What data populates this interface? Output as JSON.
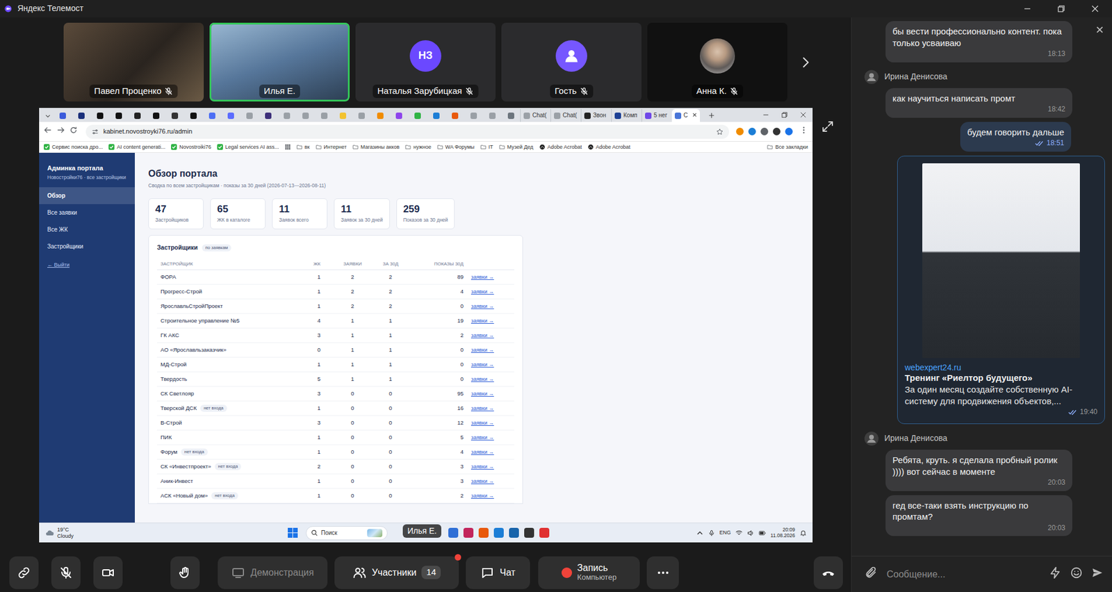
{
  "window": {
    "title": "Яндекс Телемост"
  },
  "participants": [
    {
      "name": "Павел Проценко",
      "kind": "video",
      "muted": true,
      "speaking": false
    },
    {
      "name": "Илья Е.",
      "kind": "video",
      "muted": false,
      "speaking": true
    },
    {
      "name": "Наталья Зарубицкая",
      "kind": "initials",
      "initials": "НЗ",
      "muted": true,
      "speaking": false
    },
    {
      "name": "Гость",
      "kind": "avatar",
      "muted": true,
      "speaking": false
    },
    {
      "name": "Анна К.",
      "kind": "photo",
      "muted": true,
      "speaking": false
    }
  ],
  "screen": {
    "browser": {
      "tabs": [
        {
          "kind": "icon",
          "color": "#3b5bdb",
          "selected": false
        },
        {
          "kind": "icon",
          "color": "#1a2f7a",
          "selected": false
        },
        {
          "kind": "icon",
          "color": "#111111",
          "selected": false
        },
        {
          "kind": "icon",
          "color": "#111111",
          "selected": false
        },
        {
          "kind": "icon",
          "color": "#222222",
          "selected": false
        },
        {
          "kind": "icon",
          "color": "#111111",
          "selected": false
        },
        {
          "kind": "icon",
          "color": "#333333",
          "selected": false
        },
        {
          "kind": "icon",
          "color": "#111111",
          "selected": false
        },
        {
          "kind": "icon",
          "color": "#4c6ef5",
          "selected": false
        },
        {
          "kind": "icon",
          "color": "#5b6cff",
          "selected": false
        },
        {
          "kind": "icon",
          "color": "#9aa0a6",
          "selected": false
        },
        {
          "kind": "icon",
          "color": "#3d2f7a",
          "selected": false
        },
        {
          "kind": "icon",
          "color": "#9aa0a6",
          "selected": false
        },
        {
          "kind": "icon",
          "color": "#9aa0a6",
          "selected": false
        },
        {
          "kind": "icon",
          "color": "#9aa0a6",
          "selected": false
        },
        {
          "kind": "icon",
          "color": "#f2c230",
          "selected": false
        },
        {
          "kind": "icon",
          "color": "#9aa0a6",
          "selected": false
        },
        {
          "kind": "icon",
          "color": "#f08c00",
          "selected": false
        },
        {
          "kind": "icon",
          "color": "#8e44ec",
          "selected": false
        },
        {
          "kind": "icon",
          "color": "#2fb344",
          "selected": false
        },
        {
          "kind": "icon",
          "color": "#1c7ed6",
          "selected": false
        },
        {
          "kind": "icon",
          "color": "#e8590c",
          "selected": false
        },
        {
          "kind": "icon",
          "color": "#9aa0a6",
          "selected": false
        },
        {
          "kind": "icon",
          "color": "#9aa0a6",
          "selected": false
        },
        {
          "kind": "icon",
          "color": "#6c757d",
          "selected": false
        },
        {
          "kind": "text",
          "label": "Chat(",
          "color": "#9aa0a6",
          "selected": false
        },
        {
          "kind": "text",
          "label": "Chat(",
          "color": "#9aa0a6",
          "selected": false
        },
        {
          "kind": "text",
          "label": "Звон",
          "color": "#222222",
          "selected": false
        },
        {
          "kind": "text",
          "label": "Комп",
          "color": "#1c3f94",
          "selected": false
        },
        {
          "kind": "text",
          "label": "5 нег",
          "color": "#7048e8",
          "selected": false
        },
        {
          "kind": "text",
          "label": "С",
          "color": "#4a76d8",
          "selected": true
        }
      ],
      "url": "kabinet.novostroyki76.ru/admin",
      "bookmarks": [
        {
          "kind": "check",
          "label": "Сервис поиска дро..."
        },
        {
          "kind": "check",
          "label": "AI content generati..."
        },
        {
          "kind": "check",
          "label": "Novostroiki76"
        },
        {
          "kind": "check",
          "label": "Legal services AI ass..."
        },
        {
          "kind": "folder",
          "label": "вк"
        },
        {
          "kind": "folder",
          "label": "Интернет"
        },
        {
          "kind": "folder",
          "label": "Магазины акков"
        },
        {
          "kind": "folder",
          "label": "нужное"
        },
        {
          "kind": "folder",
          "label": "WA Форумы"
        },
        {
          "kind": "folder",
          "label": "IT"
        },
        {
          "kind": "folder",
          "label": "Музей Дед"
        },
        {
          "kind": "acrobat",
          "label": "Adobe Acrobat"
        },
        {
          "kind": "acrobat",
          "label": "Adobe Acrobat"
        }
      ],
      "all_bookmarks": "Все закладки"
    },
    "portal": {
      "sidebar": {
        "title": "Админка портала",
        "subtitle": "Новостройки76 · все застройщики",
        "items": [
          {
            "label": "Обзор",
            "selected": true
          },
          {
            "label": "Все заявки",
            "selected": false
          },
          {
            "label": "Все ЖК",
            "selected": false
          },
          {
            "label": "Застройщики",
            "selected": false
          }
        ],
        "logout": "← Выйти"
      },
      "heading": "Обзор портала",
      "subheading": "Сводка по всем застройщикам · показы за 30 дней (2026-07-13—2026-08-11)",
      "stats": [
        {
          "value": "47",
          "label": "Застройщиков"
        },
        {
          "value": "65",
          "label": "ЖК в каталоге"
        },
        {
          "value": "11",
          "label": "Заявок всего"
        },
        {
          "value": "11",
          "label": "Заявок за 30 дней"
        },
        {
          "value": "259",
          "label": "Показов за 30 дней"
        }
      ],
      "table": {
        "title": "Застройщики",
        "badge": "по заявкам",
        "columns": [
          "ЗАСТРОЙЩИК",
          "ЖК",
          "ЗАЯВКИ",
          "ЗА 30Д",
          "ПОКАЗЫ 30Д"
        ],
        "rows": [
          {
            "name": "ФОРА",
            "cells": [
              "1",
              "2",
              "2",
              "89"
            ],
            "link": "заявки →"
          },
          {
            "name": "Прогресс-Строй",
            "cells": [
              "1",
              "2",
              "2",
              "4"
            ],
            "link": "заявки →"
          },
          {
            "name": "ЯрославльСтройПроект",
            "cells": [
              "1",
              "2",
              "2",
              "0"
            ],
            "link": "заявки →"
          },
          {
            "name": "Строительное управление №5",
            "cells": [
              "4",
              "1",
              "1",
              "19"
            ],
            "link": "заявки →"
          },
          {
            "name": "ГК АКС",
            "cells": [
              "3",
              "1",
              "1",
              "2"
            ],
            "link": "заявки →"
          },
          {
            "name": "АО «Ярославльзаказчик»",
            "cells": [
              "0",
              "1",
              "1",
              "0"
            ],
            "link": "заявки →"
          },
          {
            "name": "МД-Строй",
            "cells": [
              "1",
              "1",
              "1",
              "0"
            ],
            "link": "заявки →"
          },
          {
            "name": "Твердость",
            "cells": [
              "5",
              "1",
              "1",
              "0"
            ],
            "link": "заявки →"
          },
          {
            "name": "СК Светлояр",
            "cells": [
              "3",
              "0",
              "0",
              "95"
            ],
            "link": "заявки →"
          },
          {
            "name": "Тверской ДСК",
            "tag": "нет входа",
            "cells": [
              "1",
              "0",
              "0",
              "16"
            ],
            "link": "заявки →"
          },
          {
            "name": "В-Строй",
            "cells": [
              "3",
              "0",
              "0",
              "12"
            ],
            "link": "заявки →"
          },
          {
            "name": "ПИК",
            "cells": [
              "1",
              "0",
              "0",
              "5"
            ],
            "link": "заявки →"
          },
          {
            "name": "Форум",
            "tag": "нет входа",
            "cells": [
              "1",
              "0",
              "0",
              "4"
            ],
            "link": "заявки →"
          },
          {
            "name": "СК «Инвестпроект»",
            "tag": "нет входа",
            "cells": [
              "2",
              "0",
              "0",
              "3"
            ],
            "link": "заявки →"
          },
          {
            "name": "Аник-Инвест",
            "cells": [
              "1",
              "0",
              "0",
              "3"
            ],
            "link": "заявки →"
          },
          {
            "name": "АСК «Новый дом»",
            "tag": "нет входа",
            "cells": [
              "1",
              "0",
              "0",
              "2"
            ],
            "link": "заявки →"
          }
        ]
      }
    },
    "taskbar": {
      "weather": {
        "temp": "19°C",
        "desc": "Cloudy"
      },
      "search": "Поиск",
      "apps": [
        {
          "color": "#2f6fd6"
        },
        {
          "color": "#c2255c"
        },
        {
          "color": "#e8590c"
        },
        {
          "color": "#1c7ed6"
        },
        {
          "color": "#1864ab"
        },
        {
          "color": "#333333"
        },
        {
          "color": "#e03131"
        }
      ],
      "lang": "ENG",
      "time": "20:09",
      "date": "11.08.2026"
    },
    "speaker_label": "Илья Е."
  },
  "chat": {
    "messages": [
      {
        "kind": "text",
        "own": false,
        "text": "бы вести профессионально контент. пока только усваиваю",
        "time": "18:13"
      },
      {
        "kind": "text",
        "own": false,
        "author": "Ирина Денисова",
        "text": "как научиться написать промт",
        "time": "18:42"
      },
      {
        "kind": "text",
        "own": true,
        "read": true,
        "text": "будем говорить дальше",
        "time": "18:51"
      },
      {
        "kind": "link",
        "own": true,
        "read": true,
        "site": "webexpert24.ru",
        "title": "Тренинг «Риелтор будущего»",
        "desc": "За один месяц создайте собственную AI-систему для продвижения объектов,...",
        "time": "19:40"
      },
      {
        "kind": "text",
        "own": false,
        "author": "Ирина Денисова",
        "text": "Ребята, круть. я сделала пробный ролик )))) вот сейчас в моменте",
        "time": "20:03"
      },
      {
        "kind": "text",
        "own": false,
        "text": "гед все-таки взять инструкцию по промтам?",
        "time": "20:03"
      }
    ],
    "placeholder": "Сообщение..."
  },
  "toolbar": {
    "buttons": [
      {
        "kind": "link"
      },
      {
        "kind": "mic",
        "muted": true
      },
      {
        "kind": "camera",
        "off": false
      },
      {
        "kind": "hand"
      },
      {
        "kind": "share",
        "label": "Демонстрация",
        "disabled": true
      },
      {
        "kind": "participants",
        "label": "Участники",
        "count": "14",
        "notify": true
      },
      {
        "kind": "chat",
        "label": "Чат"
      },
      {
        "kind": "record",
        "label": "Запись",
        "sublabel": "Компьютер"
      },
      {
        "kind": "more"
      },
      {
        "kind": "hangup"
      }
    ]
  }
}
